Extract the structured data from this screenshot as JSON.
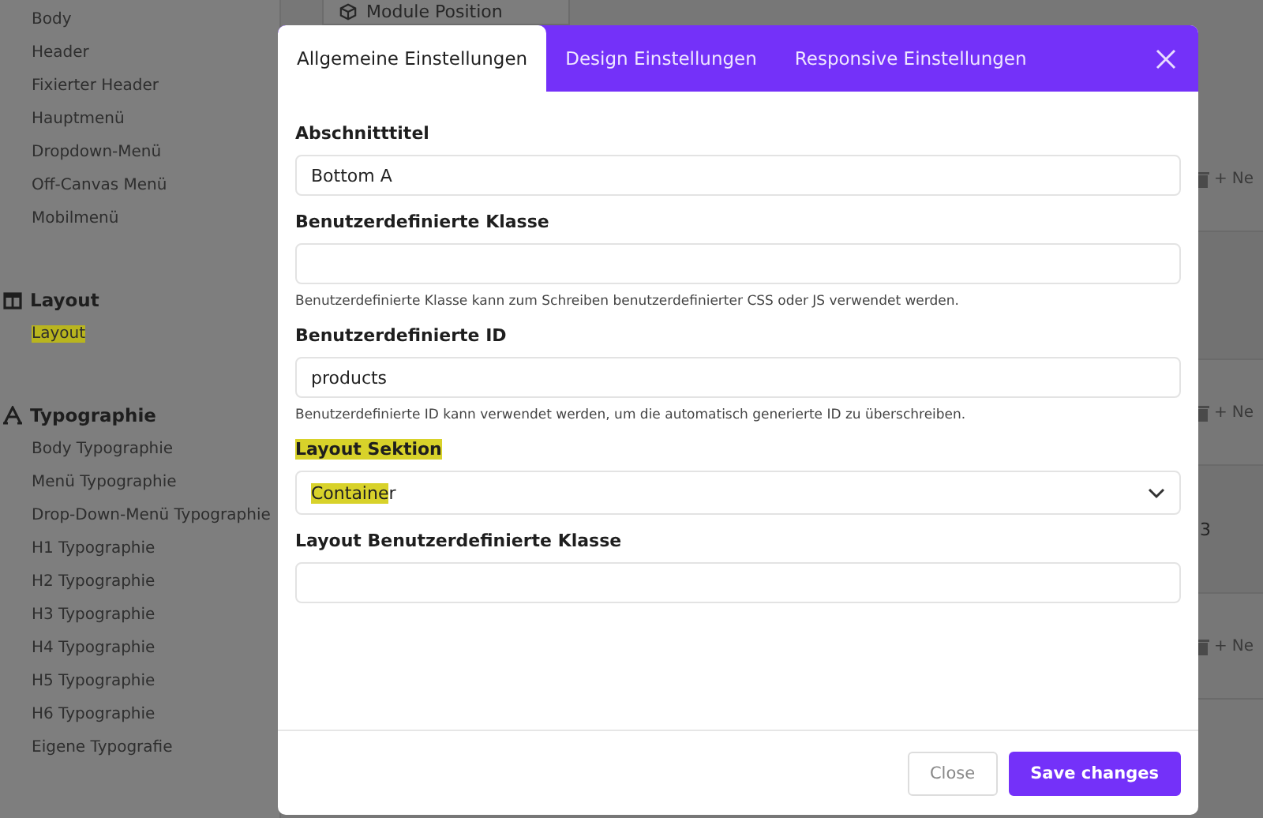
{
  "sidebar": {
    "groups": [
      {
        "items": [
          {
            "label": "Body",
            "highlighted": false
          },
          {
            "label": "Header",
            "highlighted": false
          },
          {
            "label": "Fixierter Header",
            "highlighted": false
          },
          {
            "label": "Hauptmenü",
            "highlighted": false
          },
          {
            "label": "Dropdown-Menü",
            "highlighted": false
          },
          {
            "label": "Off-Canvas Menü",
            "highlighted": false
          },
          {
            "label": "Mobilmenü",
            "highlighted": false
          }
        ]
      },
      {
        "title": "Layout",
        "items": [
          {
            "label": "Layout",
            "highlighted": true
          }
        ]
      },
      {
        "title": "Typographie",
        "items": [
          {
            "label": "Body Typographie",
            "highlighted": false
          },
          {
            "label": "Menü Typographie",
            "highlighted": false
          },
          {
            "label": "Drop-Down-Menü Typographie",
            "highlighted": false
          },
          {
            "label": "H1 Typographie",
            "highlighted": false
          },
          {
            "label": "H2 Typographie",
            "highlighted": false
          },
          {
            "label": "H3 Typographie",
            "highlighted": false
          },
          {
            "label": "H4 Typographie",
            "highlighted": false
          },
          {
            "label": "H5 Typographie",
            "highlighted": false
          },
          {
            "label": "H6 Typographie",
            "highlighted": false
          },
          {
            "label": "Eigene Typografie",
            "highlighted": false
          }
        ]
      }
    ]
  },
  "background": {
    "module_card": "Module Position",
    "rows": [
      {
        "plus": "+",
        "action": "Ne"
      },
      {
        "plus": "+",
        "action": "Ne"
      },
      {
        "plus": "+",
        "action": "Ne"
      }
    ],
    "fragment": "3"
  },
  "modal": {
    "tabs": [
      {
        "label": "Allgemeine Einstellungen",
        "selected": true
      },
      {
        "label": "Design Einstellungen",
        "selected": false
      },
      {
        "label": "Responsive Einstellungen",
        "selected": false
      }
    ],
    "fields": [
      {
        "kind": "text",
        "label": "Abschnitttitel",
        "label_highlighted": false,
        "value": "Bottom A"
      },
      {
        "kind": "text",
        "label": "Benutzerdefinierte Klasse",
        "label_highlighted": false,
        "help": "Benutzerdefinierte Klasse kann zum Schreiben benutzerdefinierter CSS oder JS verwendet werden."
      },
      {
        "kind": "text",
        "label": "Benutzerdefinierte ID",
        "label_highlighted": false,
        "value": "products",
        "help": "Benutzerdefinierte ID kann verwendet werden, um die automatisch generierte ID zu überschreiben."
      },
      {
        "kind": "select",
        "label": "Layout Sektion",
        "label_highlighted": true,
        "value_parts": [
          {
            "text": "Containe",
            "highlighted": true
          },
          {
            "text": "r",
            "highlighted": false
          }
        ]
      },
      {
        "kind": "text",
        "label": "Layout Benutzerdefinierte Klasse",
        "label_highlighted": false
      }
    ],
    "buttons": [
      {
        "label": "Close",
        "kind": "secondary"
      },
      {
        "label": "Save changes",
        "kind": "primary"
      }
    ]
  }
}
